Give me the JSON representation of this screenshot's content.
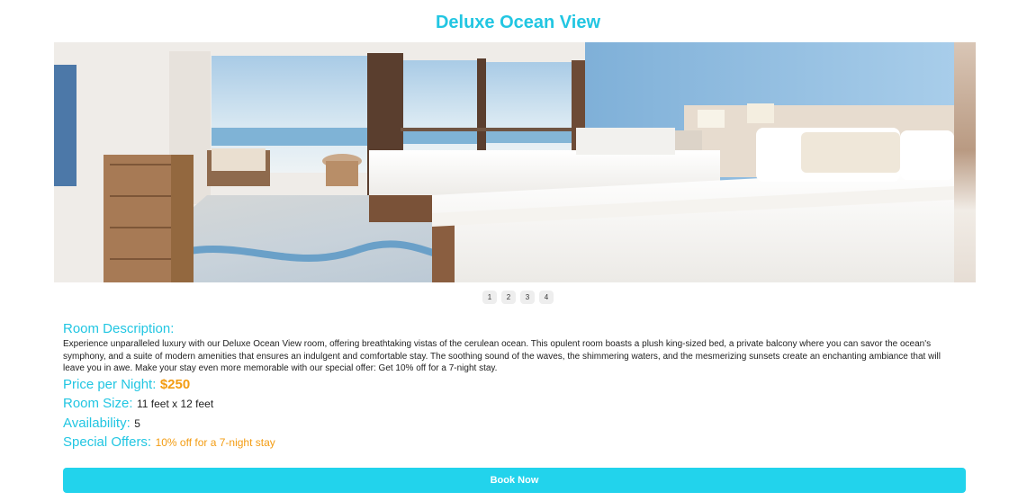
{
  "room": {
    "title": "Deluxe Ocean View"
  },
  "carousel": {
    "pages": [
      "1",
      "2",
      "3",
      "4"
    ],
    "current_slide": 1
  },
  "details": {
    "description_label": "Room Description:",
    "description": "Experience unparalleled luxury with our Deluxe Ocean View room, offering breathtaking vistas of the cerulean ocean. This opulent room boasts a plush king-sized bed, a private balcony where you can savor the ocean's symphony, and a suite of modern amenities that ensures an indulgent and comfortable stay. The soothing sound of the waves, the shimmering waters, and the mesmerizing sunsets create an enchanting ambiance that will leave you in awe. Make your stay even more memorable with our special offer: Get 10% off for a 7-night stay.",
    "price_label": "Price per Night:",
    "price": "$250",
    "size_label": "Room Size:",
    "size": "11 feet x 12 feet",
    "availability_label": "Availability:",
    "availability": "5",
    "offers_label": "Special Offers:",
    "offers": "10% off for a 7-night stay"
  },
  "actions": {
    "book_label": "Book Now"
  },
  "colors": {
    "accent": "#22c6e2",
    "button": "#22d3ec",
    "price": "#f39c12"
  }
}
